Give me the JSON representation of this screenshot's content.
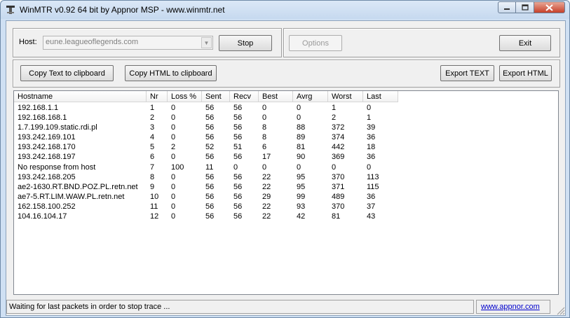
{
  "window": {
    "title": "WinMTR v0.92 64 bit by Appnor MSP - www.winmtr.net",
    "icons": {
      "app": "winmtr-app-icon",
      "minimize": "minimize-icon",
      "maximize": "maximize-icon",
      "close": "close-icon"
    }
  },
  "toolbar": {
    "host_label": "Host:",
    "host_value": "eune.leagueoflegends.com",
    "stop_label": "Stop",
    "options_label": "Options",
    "exit_label": "Exit"
  },
  "copy_bar": {
    "copy_text_label": "Copy Text to clipboard",
    "copy_html_label": "Copy HTML to clipboard",
    "export_text_label": "Export TEXT",
    "export_html_label": "Export HTML"
  },
  "table": {
    "columns": [
      "Hostname",
      "Nr",
      "Loss %",
      "Sent",
      "Recv",
      "Best",
      "Avrg",
      "Worst",
      "Last"
    ],
    "rows": [
      [
        "192.168.1.1",
        "1",
        "0",
        "56",
        "56",
        "0",
        "0",
        "1",
        "0"
      ],
      [
        "192.168.168.1",
        "2",
        "0",
        "56",
        "56",
        "0",
        "0",
        "2",
        "1"
      ],
      [
        "1.7.199.109.static.rdi.pl",
        "3",
        "0",
        "56",
        "56",
        "8",
        "88",
        "372",
        "39"
      ],
      [
        "193.242.169.101",
        "4",
        "0",
        "56",
        "56",
        "8",
        "89",
        "374",
        "36"
      ],
      [
        "193.242.168.170",
        "5",
        "2",
        "52",
        "51",
        "6",
        "81",
        "442",
        "18"
      ],
      [
        "193.242.168.197",
        "6",
        "0",
        "56",
        "56",
        "17",
        "90",
        "369",
        "36"
      ],
      [
        "No response from host",
        "7",
        "100",
        "11",
        "0",
        "0",
        "0",
        "0",
        "0"
      ],
      [
        "193.242.168.205",
        "8",
        "0",
        "56",
        "56",
        "22",
        "95",
        "370",
        "113"
      ],
      [
        "ae2-1630.RT.BND.POZ.PL.retn.net",
        "9",
        "0",
        "56",
        "56",
        "22",
        "95",
        "371",
        "115"
      ],
      [
        "ae7-5.RT.LIM.WAW.PL.retn.net",
        "10",
        "0",
        "56",
        "56",
        "29",
        "99",
        "489",
        "36"
      ],
      [
        "162.158.100.252",
        "11",
        "0",
        "56",
        "56",
        "22",
        "93",
        "370",
        "37"
      ],
      [
        "104.16.104.17",
        "12",
        "0",
        "56",
        "56",
        "22",
        "42",
        "81",
        "43"
      ]
    ]
  },
  "status": {
    "message": "Waiting for last packets in order to stop trace ...",
    "link": "www.appnor.com"
  },
  "colors": {
    "title_bar": "#dbe8f7",
    "link": "#0000cc"
  }
}
